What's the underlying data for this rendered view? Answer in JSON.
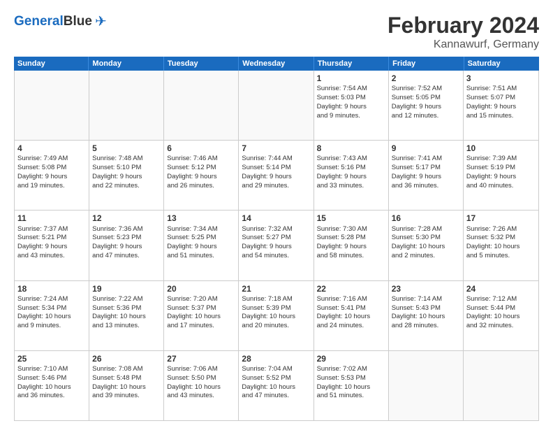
{
  "logo": {
    "part1": "General",
    "part2": "Blue"
  },
  "title": "February 2024",
  "subtitle": "Kannawurf, Germany",
  "days": [
    "Sunday",
    "Monday",
    "Tuesday",
    "Wednesday",
    "Thursday",
    "Friday",
    "Saturday"
  ],
  "rows": [
    [
      {
        "day": "",
        "content": ""
      },
      {
        "day": "",
        "content": ""
      },
      {
        "day": "",
        "content": ""
      },
      {
        "day": "",
        "content": ""
      },
      {
        "day": "1",
        "content": "Sunrise: 7:54 AM\nSunset: 5:03 PM\nDaylight: 9 hours\nand 9 minutes."
      },
      {
        "day": "2",
        "content": "Sunrise: 7:52 AM\nSunset: 5:05 PM\nDaylight: 9 hours\nand 12 minutes."
      },
      {
        "day": "3",
        "content": "Sunrise: 7:51 AM\nSunset: 5:07 PM\nDaylight: 9 hours\nand 15 minutes."
      }
    ],
    [
      {
        "day": "4",
        "content": "Sunrise: 7:49 AM\nSunset: 5:08 PM\nDaylight: 9 hours\nand 19 minutes."
      },
      {
        "day": "5",
        "content": "Sunrise: 7:48 AM\nSunset: 5:10 PM\nDaylight: 9 hours\nand 22 minutes."
      },
      {
        "day": "6",
        "content": "Sunrise: 7:46 AM\nSunset: 5:12 PM\nDaylight: 9 hours\nand 26 minutes."
      },
      {
        "day": "7",
        "content": "Sunrise: 7:44 AM\nSunset: 5:14 PM\nDaylight: 9 hours\nand 29 minutes."
      },
      {
        "day": "8",
        "content": "Sunrise: 7:43 AM\nSunset: 5:16 PM\nDaylight: 9 hours\nand 33 minutes."
      },
      {
        "day": "9",
        "content": "Sunrise: 7:41 AM\nSunset: 5:17 PM\nDaylight: 9 hours\nand 36 minutes."
      },
      {
        "day": "10",
        "content": "Sunrise: 7:39 AM\nSunset: 5:19 PM\nDaylight: 9 hours\nand 40 minutes."
      }
    ],
    [
      {
        "day": "11",
        "content": "Sunrise: 7:37 AM\nSunset: 5:21 PM\nDaylight: 9 hours\nand 43 minutes."
      },
      {
        "day": "12",
        "content": "Sunrise: 7:36 AM\nSunset: 5:23 PM\nDaylight: 9 hours\nand 47 minutes."
      },
      {
        "day": "13",
        "content": "Sunrise: 7:34 AM\nSunset: 5:25 PM\nDaylight: 9 hours\nand 51 minutes."
      },
      {
        "day": "14",
        "content": "Sunrise: 7:32 AM\nSunset: 5:27 PM\nDaylight: 9 hours\nand 54 minutes."
      },
      {
        "day": "15",
        "content": "Sunrise: 7:30 AM\nSunset: 5:28 PM\nDaylight: 9 hours\nand 58 minutes."
      },
      {
        "day": "16",
        "content": "Sunrise: 7:28 AM\nSunset: 5:30 PM\nDaylight: 10 hours\nand 2 minutes."
      },
      {
        "day": "17",
        "content": "Sunrise: 7:26 AM\nSunset: 5:32 PM\nDaylight: 10 hours\nand 5 minutes."
      }
    ],
    [
      {
        "day": "18",
        "content": "Sunrise: 7:24 AM\nSunset: 5:34 PM\nDaylight: 10 hours\nand 9 minutes."
      },
      {
        "day": "19",
        "content": "Sunrise: 7:22 AM\nSunset: 5:36 PM\nDaylight: 10 hours\nand 13 minutes."
      },
      {
        "day": "20",
        "content": "Sunrise: 7:20 AM\nSunset: 5:37 PM\nDaylight: 10 hours\nand 17 minutes."
      },
      {
        "day": "21",
        "content": "Sunrise: 7:18 AM\nSunset: 5:39 PM\nDaylight: 10 hours\nand 20 minutes."
      },
      {
        "day": "22",
        "content": "Sunrise: 7:16 AM\nSunset: 5:41 PM\nDaylight: 10 hours\nand 24 minutes."
      },
      {
        "day": "23",
        "content": "Sunrise: 7:14 AM\nSunset: 5:43 PM\nDaylight: 10 hours\nand 28 minutes."
      },
      {
        "day": "24",
        "content": "Sunrise: 7:12 AM\nSunset: 5:44 PM\nDaylight: 10 hours\nand 32 minutes."
      }
    ],
    [
      {
        "day": "25",
        "content": "Sunrise: 7:10 AM\nSunset: 5:46 PM\nDaylight: 10 hours\nand 36 minutes."
      },
      {
        "day": "26",
        "content": "Sunrise: 7:08 AM\nSunset: 5:48 PM\nDaylight: 10 hours\nand 39 minutes."
      },
      {
        "day": "27",
        "content": "Sunrise: 7:06 AM\nSunset: 5:50 PM\nDaylight: 10 hours\nand 43 minutes."
      },
      {
        "day": "28",
        "content": "Sunrise: 7:04 AM\nSunset: 5:52 PM\nDaylight: 10 hours\nand 47 minutes."
      },
      {
        "day": "29",
        "content": "Sunrise: 7:02 AM\nSunset: 5:53 PM\nDaylight: 10 hours\nand 51 minutes."
      },
      {
        "day": "",
        "content": ""
      },
      {
        "day": "",
        "content": ""
      }
    ]
  ]
}
